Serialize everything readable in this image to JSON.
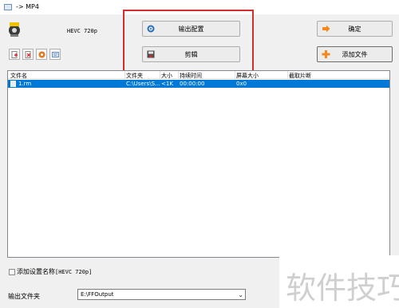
{
  "window": {
    "title": "-> MP4"
  },
  "profile": {
    "label": "HEVC 720p"
  },
  "buttons": {
    "output_config": "输出配置",
    "clip": "剪辑",
    "ok": "确定",
    "add_file": "添加文件"
  },
  "file_list": {
    "columns": [
      "文件名",
      "文件夹",
      "大小",
      "持续时间",
      "屏幕大小",
      "截取片断"
    ],
    "rows": [
      {
        "name": "1.rm",
        "folder": "C:\\Users\\S...",
        "size": "<1K",
        "duration": "00:00:00",
        "screen": "0x0",
        "clip": ""
      }
    ]
  },
  "options": {
    "add_setting_name": "添加设置名称",
    "add_setting_value": "[HEVC 720p]"
  },
  "output_folder": {
    "label": "输出文件夹",
    "value": "E:\\FFOutput"
  },
  "watermark": {
    "text": "软件技巧"
  },
  "colors": {
    "selection": "#0078d7",
    "highlight_box": "#d62c2c"
  }
}
